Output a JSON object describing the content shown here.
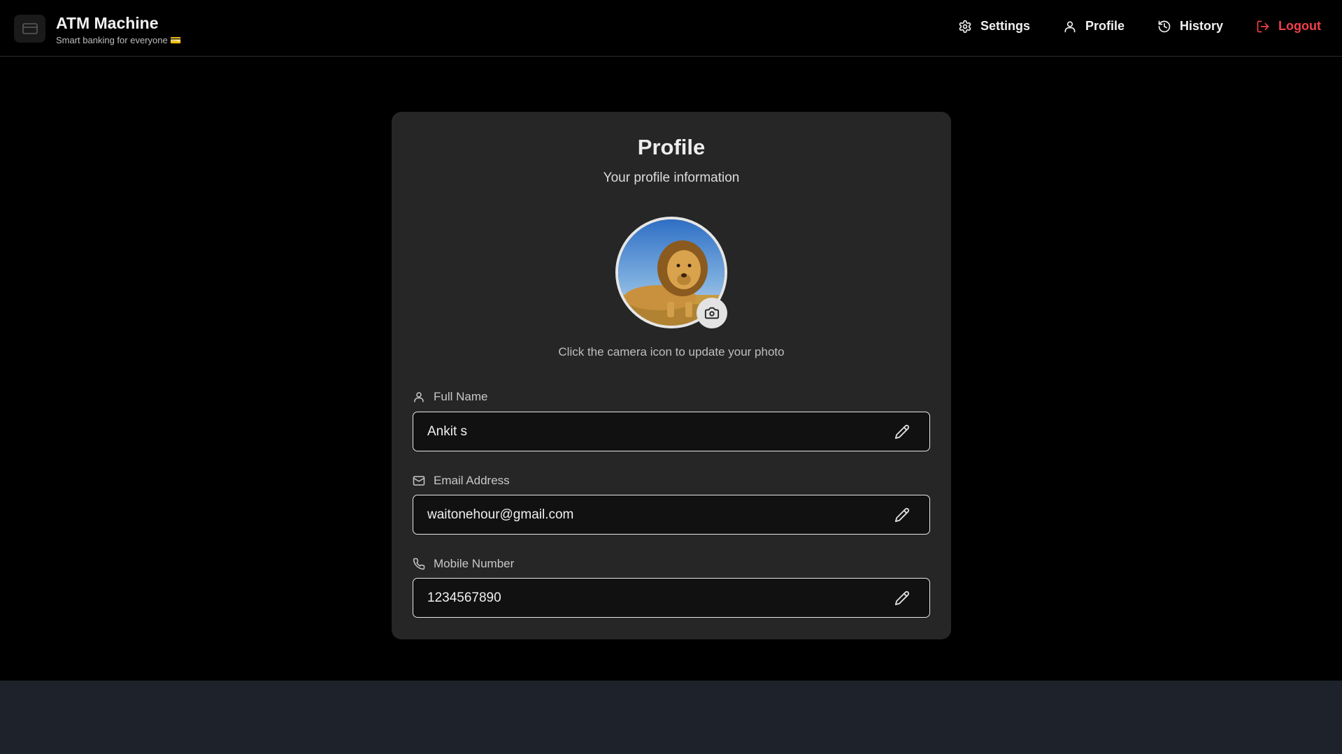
{
  "header": {
    "brand_icon": "credit-card-icon",
    "title": "ATM Machine",
    "subtitle": "Smart banking for everyone 💳",
    "nav": [
      {
        "label": "Settings",
        "icon": "gear-icon"
      },
      {
        "label": "Profile",
        "icon": "user-icon"
      },
      {
        "label": "History",
        "icon": "history-icon"
      },
      {
        "label": "Logout",
        "icon": "logout-icon",
        "color": "#f0404a"
      }
    ]
  },
  "profile": {
    "title": "Profile",
    "subtitle": "Your profile information",
    "avatar_alt": "lion photo",
    "hint": "Click the camera icon to update your photo",
    "fields": [
      {
        "label": "Full Name",
        "icon": "user-icon",
        "value": "Ankit s"
      },
      {
        "label": "Email Address",
        "icon": "mail-icon",
        "value": "waitonehour@gmail.com"
      },
      {
        "label": "Mobile Number",
        "icon": "phone-icon",
        "value": "1234567890"
      }
    ]
  },
  "colors": {
    "background": "#000000",
    "card": "#262626",
    "footer": "#1e232b",
    "logout": "#f0404a"
  }
}
